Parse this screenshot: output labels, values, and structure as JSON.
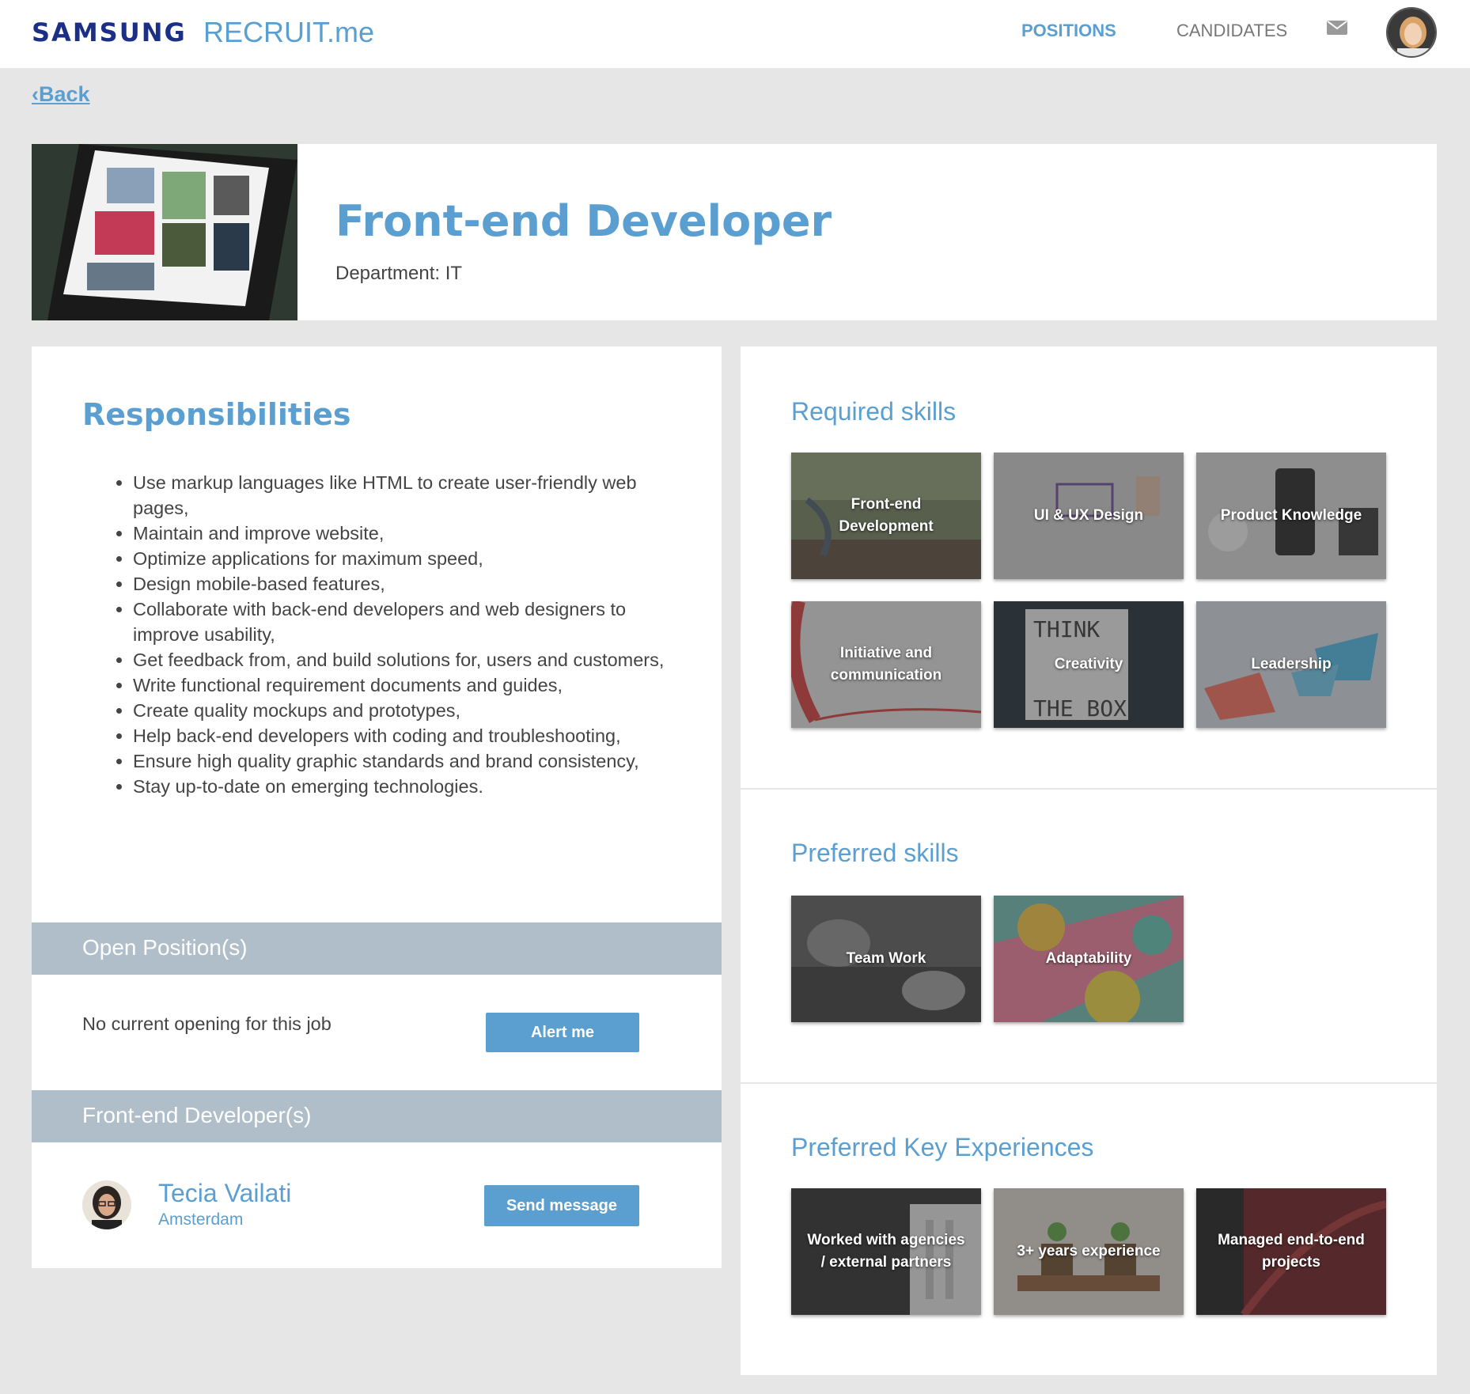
{
  "topbar": {
    "brand": "SAMSUNG",
    "app_name": "RECRUIT.me",
    "nav_positions": "POSITIONS",
    "nav_candidates": "CANDIDATES",
    "accent_color": "#5b9fd1",
    "brand_color": "#1b2f86"
  },
  "back_label": "Back",
  "job": {
    "title": "Front-end Developer",
    "department": "Department: IT"
  },
  "responsibilities": {
    "title": "Responsibilities",
    "items": [
      "Use markup languages like HTML to create user-friendly web pages,",
      "Maintain and improve website,",
      "Optimize applications for maximum speed,",
      "Design mobile-based features,",
      "Collaborate with back-end developers and web designers to improve usability,",
      "Get feedback from, and build solutions for, users and customers,",
      "Write functional requirement documents and guides,",
      "Create quality mockups and prototypes,",
      "Help back-end developers with coding and troubleshooting,",
      "Ensure high quality graphic standards and brand consistency,",
      "Stay up-to-date on emerging technologies."
    ]
  },
  "open_positions": {
    "title": "Open Position(s)",
    "status": "No current opening for this job",
    "button": "Alert me"
  },
  "developers": {
    "title": "Front-end Developer(s)",
    "person": {
      "name": "Tecia Vailati",
      "city": "Amsterdam"
    },
    "button": "Send message"
  },
  "required_skills": {
    "title": "Required skills",
    "items": [
      "Front-end Development",
      "UI & UX Design",
      "Product Knowledge",
      "Initiative and communication",
      "Creativity",
      "Leadership"
    ]
  },
  "preferred_skills": {
    "title": "Preferred skills",
    "items": [
      "Team Work",
      "Adaptability"
    ]
  },
  "key_experiences": {
    "title": "Preferred Key Experiences",
    "items": [
      "Worked with agencies / external partners",
      "3+ years experience",
      "Managed end-to-end projects"
    ]
  }
}
